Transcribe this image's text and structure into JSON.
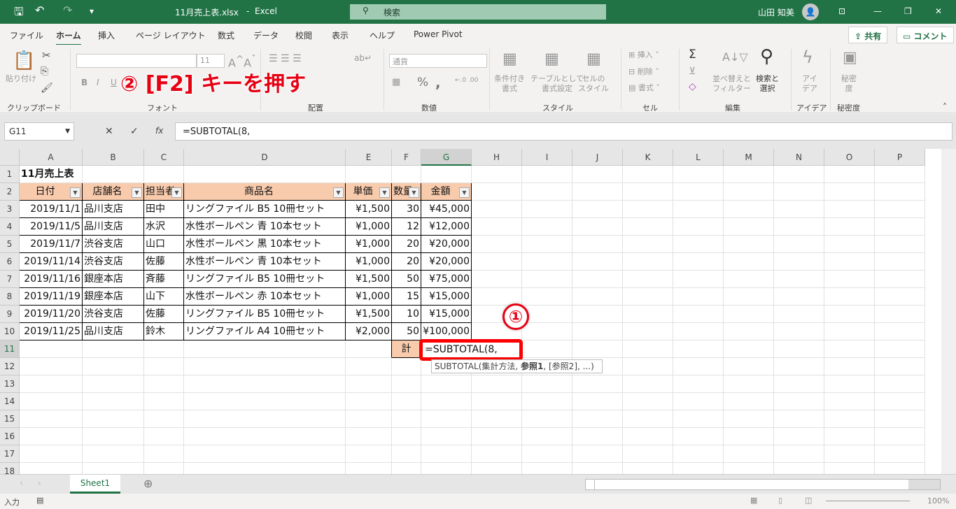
{
  "titlebar": {
    "filename": "11月売上表.xlsx",
    "separator": "-",
    "app": "Excel",
    "search_placeholder": "検索",
    "user": "山田 知美",
    "colors": {
      "accent": "#217346"
    }
  },
  "menu": {
    "tabs": [
      "ファイル",
      "ホーム",
      "挿入",
      "ページ レイアウト",
      "数式",
      "データ",
      "校閲",
      "表示",
      "ヘルプ",
      "Power Pivot"
    ],
    "active": "ホーム",
    "share": "共有",
    "comment": "コメント"
  },
  "ribbon": {
    "clipboard": {
      "paste": "貼り付け",
      "group": "クリップボード"
    },
    "font": {
      "font_size": "11",
      "bold": "B",
      "italic": "I",
      "underline": "U",
      "group": "フォント"
    },
    "alignment": {
      "group": "配置"
    },
    "number": {
      "format": "通貨",
      "percent": "%",
      "comma": ",",
      "group": "数値"
    },
    "styles": {
      "conditional": "条件付き\n書式",
      "table": "テーブルとして\n書式設定",
      "cell": "セルの\nスタイル",
      "group": "スタイル"
    },
    "cells": {
      "insert": "挿入",
      "delete": "削除",
      "format": "書式",
      "group": "セル"
    },
    "editing": {
      "sum": "Σ",
      "sort": "並べ替えと\nフィルター",
      "find": "検索と\n選択",
      "group": "編集"
    },
    "ideas": {
      "label": "アイ\nデア",
      "group": "アイデア"
    },
    "sensitivity": {
      "label": "秘密\n度",
      "group": "秘密度"
    }
  },
  "annotation2": "② [F2] キーを押す",
  "annotation1": "①",
  "formula_bar": {
    "name_box": "G11",
    "cancel": "✕",
    "enter": "✓",
    "fx": "fx",
    "formula": "=SUBTOTAL(8,"
  },
  "columns": [
    "A",
    "B",
    "C",
    "D",
    "E",
    "F",
    "G",
    "H",
    "I",
    "J",
    "K",
    "L",
    "M",
    "N",
    "O",
    "P"
  ],
  "rows": [
    "1",
    "2",
    "3",
    "4",
    "5",
    "6",
    "7",
    "8",
    "9",
    "10",
    "11",
    "12",
    "13",
    "14",
    "15",
    "16",
    "17",
    "18"
  ],
  "sheet": {
    "title": "11月売上表",
    "headers": [
      "日付",
      "店舗名",
      "担当者",
      "商品名",
      "単価",
      "数量",
      "金額"
    ],
    "data": [
      [
        "2019/11/1",
        "品川支店",
        "田中",
        "リングファイル B5 10冊セット",
        "¥1,500",
        "30",
        "¥45,000"
      ],
      [
        "2019/11/5",
        "品川支店",
        "水沢",
        "水性ボールペン 青 10本セット",
        "¥1,000",
        "12",
        "¥12,000"
      ],
      [
        "2019/11/7",
        "渋谷支店",
        "山口",
        "水性ボールペン 黒 10本セット",
        "¥1,000",
        "20",
        "¥20,000"
      ],
      [
        "2019/11/14",
        "渋谷支店",
        "佐藤",
        "水性ボールペン 青 10本セット",
        "¥1,000",
        "20",
        "¥20,000"
      ],
      [
        "2019/11/16",
        "銀座本店",
        "斉藤",
        "リングファイル B5 10冊セット",
        "¥1,500",
        "50",
        "¥75,000"
      ],
      [
        "2019/11/19",
        "銀座本店",
        "山下",
        "水性ボールペン 赤 10本セット",
        "¥1,000",
        "15",
        "¥15,000"
      ],
      [
        "2019/11/20",
        "渋谷支店",
        "佐藤",
        "リングファイル B5 10冊セット",
        "¥1,500",
        "10",
        "¥15,000"
      ],
      [
        "2019/11/25",
        "品川支店",
        "鈴木",
        "リングファイル A4 10冊セット",
        "¥2,000",
        "50",
        "¥100,000"
      ]
    ],
    "total_label": "計",
    "editing_value": "=SUBTOTAL(8,",
    "tooltip": {
      "func": "SUBTOTAL(集計方法, ",
      "bold": "参照1",
      "rest": ", [参照2], ...)"
    }
  },
  "sheet_tabs": [
    "Sheet1"
  ],
  "status": {
    "mode": "入力",
    "zoom": "100%"
  },
  "colors": {
    "header_fill": "#f8cbad",
    "highlight": "#ff0000"
  }
}
